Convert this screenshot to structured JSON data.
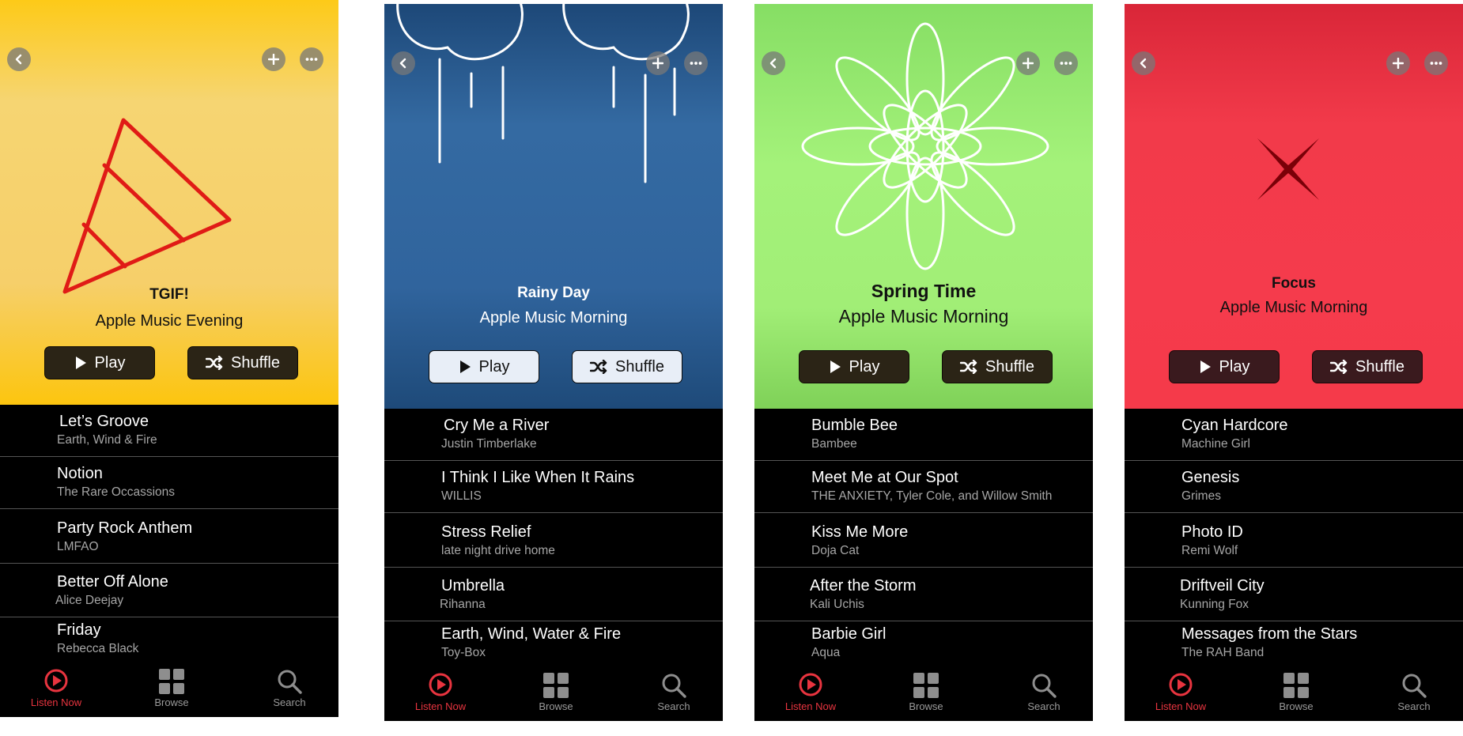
{
  "colors": {
    "accent": "#e8343f",
    "list_bg": "#000000",
    "inactive_tab": "#9a9a9a"
  },
  "icons": {
    "back": "chevron-left-icon",
    "add": "plus-icon",
    "more": "ellipsis-icon",
    "play": "play-icon",
    "shuffle": "shuffle-icon",
    "listen_now": "play-circle-icon",
    "browse": "grid-icon",
    "search": "magnifier-icon"
  },
  "buttons": {
    "play": "Play",
    "shuffle": "Shuffle"
  },
  "tabs": {
    "listen_now": "Listen Now",
    "browse": "Browse",
    "search": "Search"
  },
  "playlists": [
    {
      "title": "TGIF!",
      "subtitle": "Apple Music Evening",
      "theme_color": "#f6d06e",
      "art": "triangle-wedge",
      "songs": [
        {
          "title": "Let’s Groove",
          "artist": "Earth, Wind & Fire"
        },
        {
          "title": "Notion",
          "artist": "The Rare Occassions"
        },
        {
          "title": "Party Rock Anthem",
          "artist": "LMFAO"
        },
        {
          "title": "Better Off Alone",
          "artist": "Alice Deejay"
        },
        {
          "title": "Friday",
          "artist": "Rebecca Black"
        }
      ]
    },
    {
      "title": "Rainy Day",
      "subtitle": "Apple Music Morning",
      "theme_color": "#30649d",
      "art": "rain-clouds",
      "songs": [
        {
          "title": "Cry Me a River",
          "artist": "Justin Timberlake"
        },
        {
          "title": "I Think I Like When It Rains",
          "artist": "WILLIS"
        },
        {
          "title": "Stress Relief",
          "artist": "late night drive home"
        },
        {
          "title": "Umbrella",
          "artist": "Rihanna"
        },
        {
          "title": "Earth, Wind, Water & Fire",
          "artist": "Toy-Box"
        }
      ]
    },
    {
      "title": "Spring Time",
      "subtitle": "Apple Music Morning",
      "theme_color": "#a1ee76",
      "art": "flower",
      "songs": [
        {
          "title": "Bumble Bee",
          "artist": "Bambee"
        },
        {
          "title": "Meet Me at Our Spot",
          "artist": "THE ANXIETY, Tyler Cole, and Willow Smith"
        },
        {
          "title": "Kiss Me More",
          "artist": "Doja Cat"
        },
        {
          "title": "After the Storm",
          "artist": "Kali Uchis"
        },
        {
          "title": "Barbie Girl",
          "artist": "Aqua"
        }
      ]
    },
    {
      "title": "Focus",
      "subtitle": "Apple Music Morning",
      "theme_color": "#f53b4c",
      "art": "x-star",
      "songs": [
        {
          "title": "Cyan Hardcore",
          "artist": "Machine Girl"
        },
        {
          "title": "Genesis",
          "artist": "Grimes"
        },
        {
          "title": "Photo ID",
          "artist": "Remi Wolf"
        },
        {
          "title": "Driftveil City",
          "artist": "Kunning Fox"
        },
        {
          "title": "Messages from the Stars",
          "artist": "The RAH Band"
        }
      ]
    }
  ]
}
